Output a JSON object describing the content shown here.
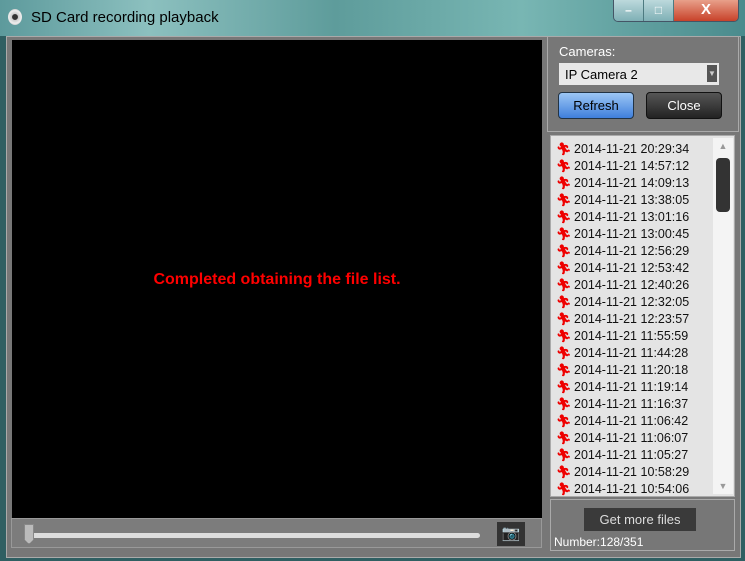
{
  "window": {
    "title": "SD Card recording playback",
    "minimize": "–",
    "maximize": "□",
    "close": "X"
  },
  "video": {
    "message": "Completed obtaining the file list.",
    "message_color": "#ff0000",
    "progress": 0
  },
  "cameras": {
    "label": "Cameras:",
    "selected": "IP Camera 2"
  },
  "buttons": {
    "refresh": "Refresh",
    "close": "Close",
    "get_more": "Get more files"
  },
  "files": [
    "2014-11-21 20:29:34",
    "2014-11-21 14:57:12",
    "2014-11-21 14:09:13",
    "2014-11-21 13:38:05",
    "2014-11-21 13:01:16",
    "2014-11-21 13:00:45",
    "2014-11-21 12:56:29",
    "2014-11-21 12:53:42",
    "2014-11-21 12:40:26",
    "2014-11-21 12:32:05",
    "2014-11-21 12:23:57",
    "2014-11-21 11:55:59",
    "2014-11-21 11:44:28",
    "2014-11-21 11:20:18",
    "2014-11-21 11:19:14",
    "2014-11-21 11:16:37",
    "2014-11-21 11:06:42",
    "2014-11-21 11:06:07",
    "2014-11-21 11:05:27",
    "2014-11-21 10:58:29",
    "2014-11-21 10:54:06"
  ],
  "file_icon": "running-man-icon",
  "status": {
    "number": "Number:128/351"
  }
}
